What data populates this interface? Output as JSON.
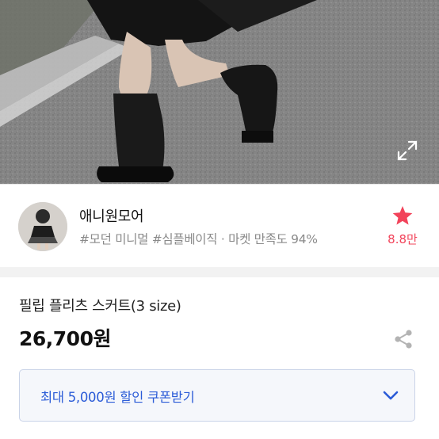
{
  "store": {
    "name": "애니원모어",
    "tags": "#모던 미니멀 #심플베이직 · 마켓 만족도 94%",
    "favorite_count": "8.8만"
  },
  "product": {
    "name": "필립 플리츠 스커트(3 size)",
    "price": "26,700원"
  },
  "coupon": {
    "label": "최대 5,000원 할인 쿠폰받기"
  },
  "icons": {
    "expand": "expand-icon",
    "favorite": "star-icon",
    "share": "share-icon",
    "chevron": "chevron-down-icon"
  },
  "colors": {
    "accent_red": "#f2435a",
    "coupon_blue": "#2a5bd7",
    "coupon_bg": "#f5f7fb"
  }
}
